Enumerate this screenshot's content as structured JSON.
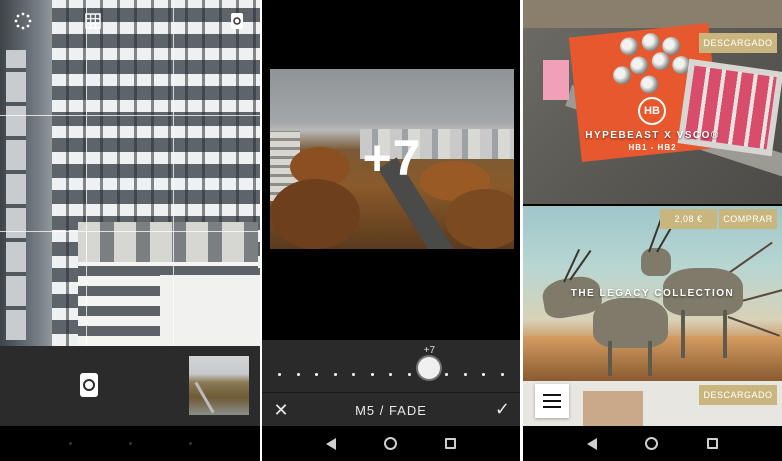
{
  "camera": {
    "icons": [
      "settings-icon",
      "grid-icon",
      "flip-camera-icon",
      "shutter-icon"
    ]
  },
  "editor": {
    "value_overlay": "+7",
    "slider_value": "+7",
    "slider_level": 0.67,
    "preset_name": "M5 / FADE",
    "cancel_icon": "close-icon",
    "confirm_icon": "check-icon"
  },
  "store": {
    "items": [
      {
        "logo": "HB",
        "title": "HYPEBEAST X VSCO®",
        "subtitle": "HB1 - HB2",
        "status_label": "DESCARGADO"
      },
      {
        "title": "THE LEGACY COLLECTION",
        "price": "2,08 €",
        "buy_label": "COMPRAR"
      },
      {
        "status_label": "DESCARGADO"
      }
    ]
  },
  "colors": {
    "badge": "#c9b67e",
    "panel_dark": "#2a2a2a"
  }
}
